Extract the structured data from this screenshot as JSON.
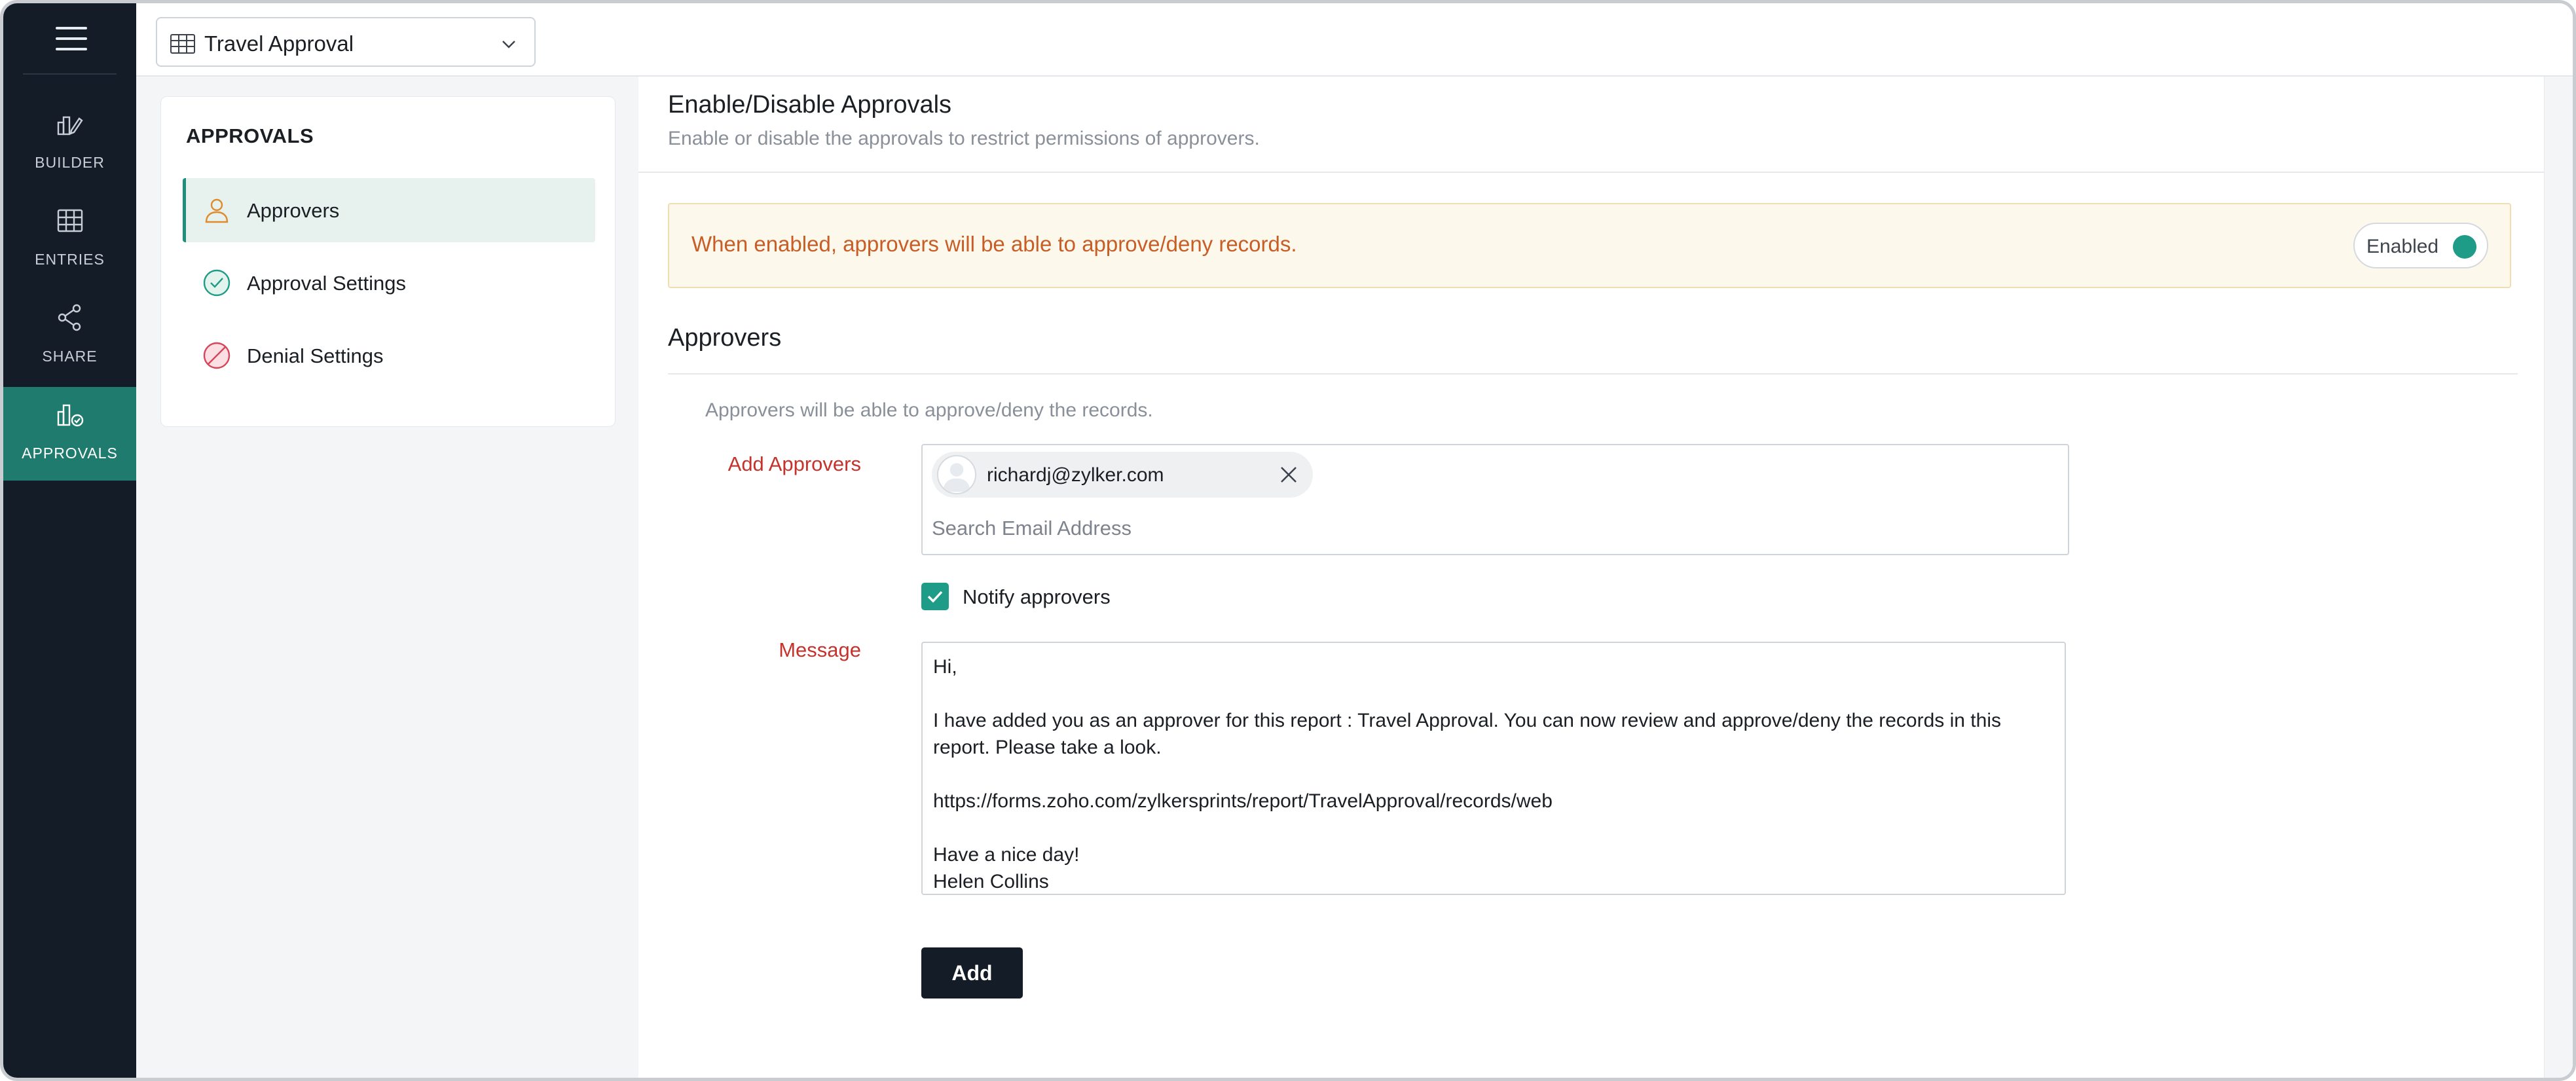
{
  "header": {
    "report_name": "Travel Approval"
  },
  "nav_rail": {
    "items": [
      {
        "label": "BUILDER",
        "icon": "builder-icon"
      },
      {
        "label": "ENTRIES",
        "icon": "grid-icon"
      },
      {
        "label": "SHARE",
        "icon": "share-icon"
      },
      {
        "label": "APPROVALS",
        "icon": "approvals-icon",
        "active": true
      }
    ]
  },
  "side_panel": {
    "title": "APPROVALS",
    "items": [
      {
        "label": "Approvers",
        "icon": "person-icon",
        "active": true
      },
      {
        "label": "Approval Settings",
        "icon": "check-circle-icon"
      },
      {
        "label": "Denial Settings",
        "icon": "deny-circle-icon"
      }
    ]
  },
  "main": {
    "title": "Enable/Disable Approvals",
    "subtitle": "Enable or disable the approvals to restrict permissions of approvers.",
    "notice": {
      "text": "When enabled, approvers will be able to approve/deny records.",
      "toggle_label": "Enabled",
      "toggle_on": true
    },
    "approvers": {
      "title": "Approvers",
      "subtitle": "Approvers will be able to approve/deny the records.",
      "add_label": "Add Approvers",
      "chip_email": "richardj@zylker.com",
      "search_placeholder": "Search Email Address",
      "notify_label": "Notify approvers",
      "notify_checked": true,
      "message_label": "Message",
      "message_text": "Hi,\n\nI have added you as an approver for this report : Travel Approval. You can now review and approve/deny the records in this report. Please take a look.\n\nhttps://forms.zoho.com/zylkersprints/report/TravelApproval/records/web\n\nHave a nice day!\nHelen Collins",
      "add_button": "Add"
    }
  },
  "colors": {
    "rail_bg": "#141c27",
    "accent": "#1f7b6d",
    "toggle_on": "#1f9c87",
    "notice_text": "#c85d26",
    "label_red": "#c6322c"
  }
}
